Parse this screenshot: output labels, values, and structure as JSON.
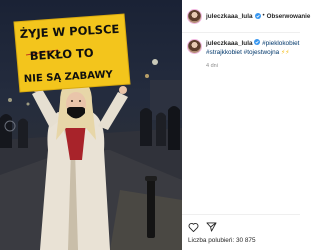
{
  "post": {
    "sign_lines": [
      "ŻYJE W POLSCE",
      "BEKŁO TO",
      "NIE SĄ ZABAWY"
    ]
  },
  "header": {
    "username": "juleczkaaa_lula",
    "separator": "•",
    "follow_label": "Obserwowanie"
  },
  "caption": {
    "username": "juleczkaaa_lula",
    "hashtags": [
      "#pieklokobiet",
      "#strajkkobiet",
      "#tojestwojna"
    ],
    "emoji": "⚡⚡",
    "time": "4 dni"
  },
  "stats": {
    "likes_label": "Liczba polubień: 30 875"
  },
  "colors": {
    "sign": "#f3c51c",
    "verified": "#3897f0",
    "hashtag": "#00376b"
  }
}
